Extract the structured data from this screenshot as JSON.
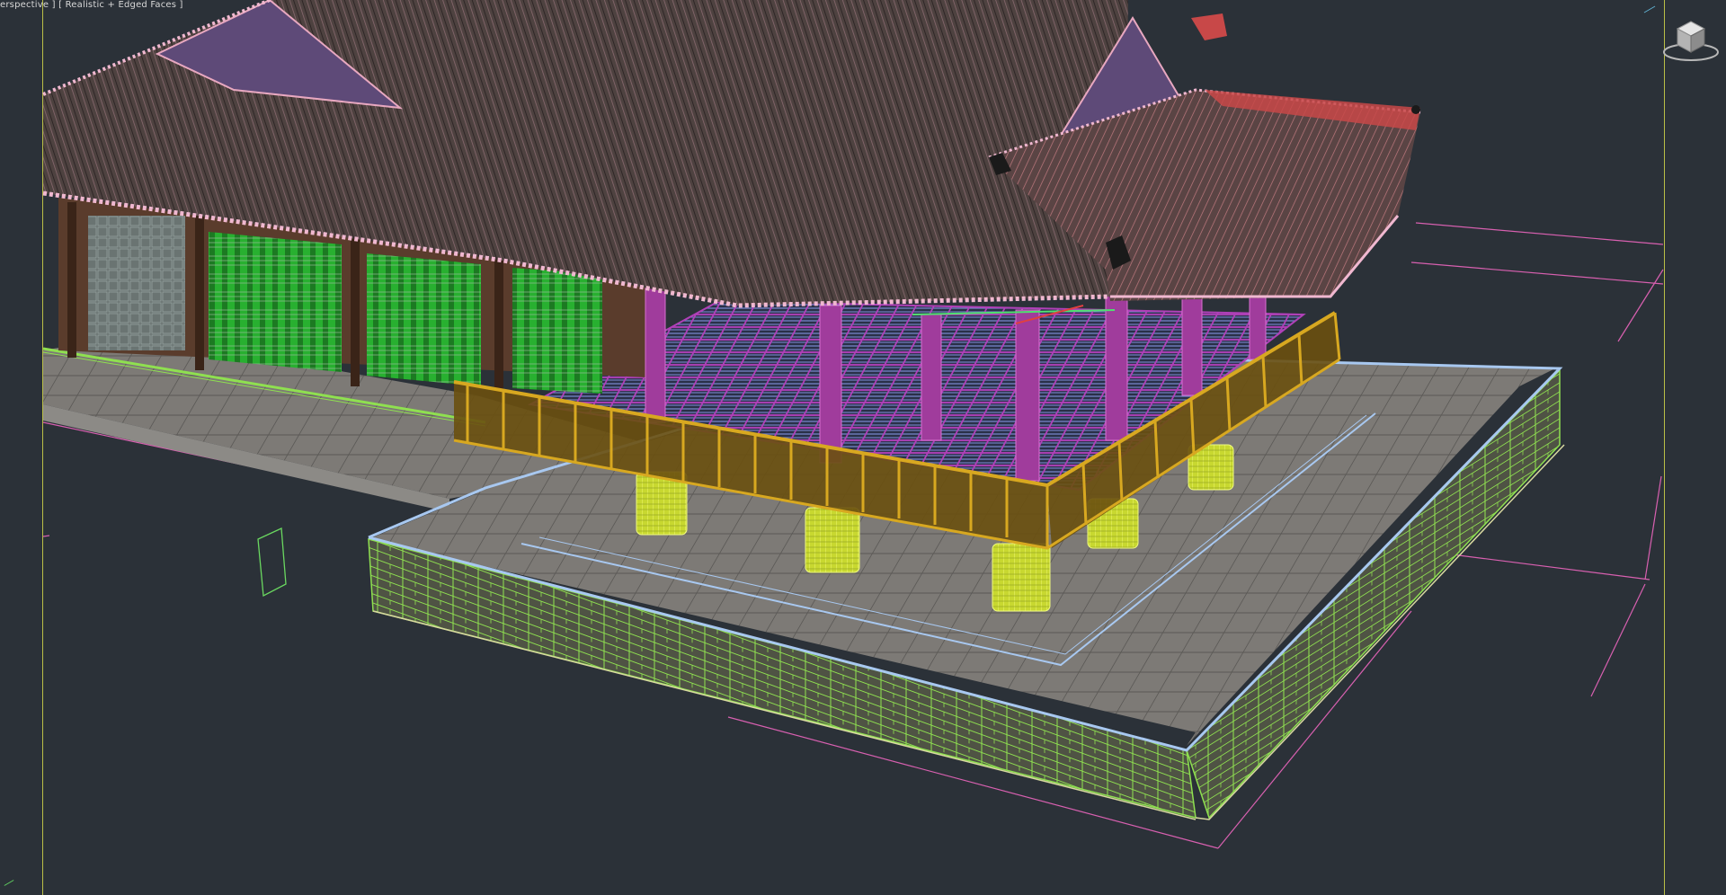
{
  "viewport": {
    "label": "erspective ] [ Realistic + Edged Faces ]",
    "background": "#2b3138"
  },
  "icons": {
    "viewcube": "viewcube-icon"
  },
  "colors": {
    "roof": "#5a4a48",
    "roof_edges": "#e8a8c0",
    "columns": "#a03c9c",
    "railing": "#a88418",
    "pillar_bases": "#d8e838",
    "platform_floor": "#7d7a76",
    "stone_wall_edges": "#8fe050",
    "border_edges": "#a8c8f0",
    "grid_lines": "#d860b0",
    "panels": "#22a02a"
  }
}
